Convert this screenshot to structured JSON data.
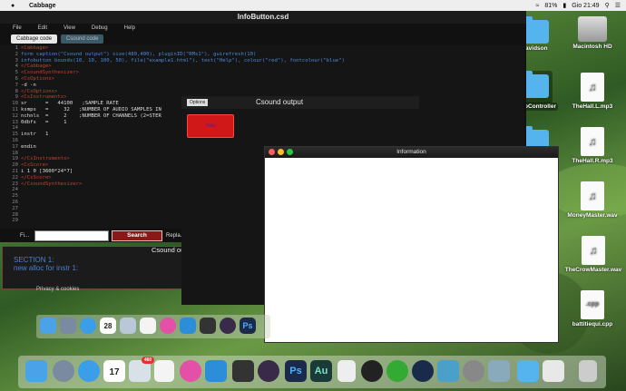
{
  "menubar": {
    "app": "Cabbage",
    "battery": "81%",
    "clock": "Gio 21:49"
  },
  "cabbage_window": {
    "title": "InfoButton.csd",
    "menu": [
      "File",
      "Edit",
      "View",
      "Debug",
      "Help"
    ],
    "tabs": [
      "Cabbage code",
      "Csound code"
    ],
    "code_lines": [
      {
        "n": "1",
        "t": "<Cabbage>",
        "c": "c-tag"
      },
      {
        "n": "2",
        "t": "form caption(\"Csound output\") size(480,400), pluginID(\"RMs1\"), guirefresh(10)",
        "c": "c-code"
      },
      {
        "n": "3",
        "t": "infobutton bounds(10, 10, 100, 50), file(\"example1.html\"), text(\"Help\"), colour(\"red\"), fontcolour(\"blue\")",
        "c": "c-code"
      },
      {
        "n": "4",
        "t": "</Cabbage>",
        "c": "c-tag"
      },
      {
        "n": "5",
        "t": "<CsoundSynthesizer>",
        "c": "c-tag"
      },
      {
        "n": "6",
        "t": "<CsOptions>",
        "c": "c-tag"
      },
      {
        "n": "7",
        "t": "-d -n",
        "c": "c-plain"
      },
      {
        "n": "8",
        "t": "</CsOptions>",
        "c": "c-tag"
      },
      {
        "n": "9",
        "t": "<CsInstruments>",
        "c": "c-tag"
      },
      {
        "n": "10",
        "t": "sr      =   44100   ;SAMPLE RATE",
        "c": "c-plain"
      },
      {
        "n": "11",
        "t": "ksmps   =     32   ;NUMBER OF AUDIO SAMPLES IN",
        "c": "c-plain"
      },
      {
        "n": "12",
        "t": "nchnls  =     2    ;NUMBER OF CHANNELS (2=STER",
        "c": "c-plain"
      },
      {
        "n": "13",
        "t": "0dbfs   =     1",
        "c": "c-plain"
      },
      {
        "n": "14",
        "t": "",
        "c": "c-plain"
      },
      {
        "n": "15",
        "t": "instr   1",
        "c": "c-plain"
      },
      {
        "n": "16",
        "t": "",
        "c": "c-plain"
      },
      {
        "n": "17",
        "t": "endin",
        "c": "c-plain"
      },
      {
        "n": "18",
        "t": "",
        "c": "c-plain"
      },
      {
        "n": "19",
        "t": "</CsInstruments>",
        "c": "c-tag"
      },
      {
        "n": "20",
        "t": "<CsScore>",
        "c": "c-tag"
      },
      {
        "n": "21",
        "t": "i 1 0 [3600*24*7]",
        "c": "c-plain"
      },
      {
        "n": "22",
        "t": "</CsScore>",
        "c": "c-tag"
      },
      {
        "n": "23",
        "t": "</CsoundSynthesizer>",
        "c": "c-tag"
      },
      {
        "n": "24",
        "t": "",
        "c": "c-plain"
      },
      {
        "n": "25",
        "t": "",
        "c": "c-plain"
      },
      {
        "n": "26",
        "t": "",
        "c": "c-plain"
      },
      {
        "n": "27",
        "t": "",
        "c": "c-plain"
      },
      {
        "n": "28",
        "t": "",
        "c": "c-plain"
      },
      {
        "n": "29",
        "t": "",
        "c": "c-plain"
      }
    ],
    "find_label": "Fi...",
    "find_value": "",
    "search_label": "Search",
    "replace_label": "Repla..."
  },
  "console": {
    "line1": "SECTION 1:",
    "line2": "new alloc for instr 1:",
    "privacy": "Privacy & cookies"
  },
  "csound_output": {
    "title": "Csound output",
    "options": "Options",
    "help_button": "Help",
    "behind_title": "Csound ou"
  },
  "info_window": {
    "title": "Information"
  },
  "desktop": {
    "icons": [
      "Macintosh HD",
      "Davidson",
      "TheHall.L.mp3",
      "PiezoController",
      "TheHall.R.mp3",
      "MoneyMaster.wav",
      "TheCrowMaster.wav",
      "battitiequi.cpp"
    ],
    "cpp_badge": ".cpp"
  },
  "dock": {
    "calendar_day": "28",
    "calendar_day2": "17",
    "photoshop": "Ps",
    "audition": "Au",
    "badge": "460"
  }
}
